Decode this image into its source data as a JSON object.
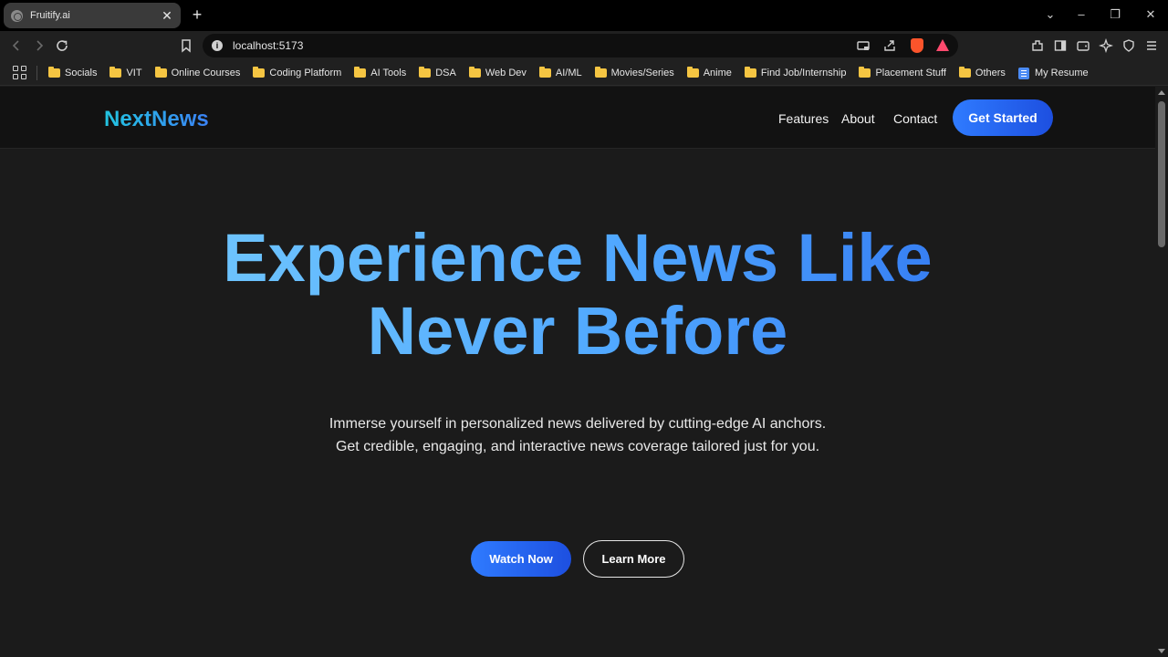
{
  "browser": {
    "tab": {
      "title": "Fruitify.ai",
      "close_glyph": "✕"
    },
    "newtab_glyph": "+",
    "window_controls": {
      "dropdown": "⌄",
      "minimize": "–",
      "restore": "❐",
      "close": "✕"
    },
    "toolbar": {
      "url": "localhost:5173",
      "info_glyph": "i",
      "icons": [
        "back-icon",
        "forward-icon",
        "reload-icon",
        "bookmark-icon",
        "cast-icon",
        "share-icon",
        "brave-shields-icon",
        "brave-rewards-icon",
        "extensions-icon",
        "sidebar-icon",
        "wallet-icon",
        "leo-ai-icon",
        "vpn-icon",
        "menu-icon"
      ]
    },
    "bookmarks": [
      {
        "label": "Socials",
        "icon": "folder"
      },
      {
        "label": "VIT",
        "icon": "folder"
      },
      {
        "label": "Online Courses",
        "icon": "folder"
      },
      {
        "label": "Coding Platform",
        "icon": "folder"
      },
      {
        "label": "AI Tools",
        "icon": "folder"
      },
      {
        "label": "DSA",
        "icon": "folder"
      },
      {
        "label": "Web Dev",
        "icon": "folder"
      },
      {
        "label": "AI/ML",
        "icon": "folder"
      },
      {
        "label": "Movies/Series",
        "icon": "folder"
      },
      {
        "label": "Anime",
        "icon": "folder"
      },
      {
        "label": "Find Job/Internship",
        "icon": "folder"
      },
      {
        "label": "Placement Stuff",
        "icon": "folder"
      },
      {
        "label": "Others",
        "icon": "folder"
      },
      {
        "label": "My Resume",
        "icon": "doc"
      }
    ]
  },
  "site": {
    "logo": "NextNews",
    "nav": {
      "features": "Features",
      "about": "About",
      "contact": "Contact",
      "cta": "Get Started"
    },
    "hero": {
      "title_line1": "Experience News Like",
      "title_line2": "Never Before",
      "subtitle": "Immerse yourself in personalized news delivered by cutting-edge AI anchors. Get credible, engaging, and interactive news coverage tailored just for you.",
      "watch_button": "Watch Now",
      "learn_button": "Learn More"
    },
    "colors": {
      "accent_blue": "#2f7bff",
      "logo_cyan": "#22c4e0",
      "page_bg": "#1b1b1b",
      "nav_bg": "#121212"
    }
  }
}
